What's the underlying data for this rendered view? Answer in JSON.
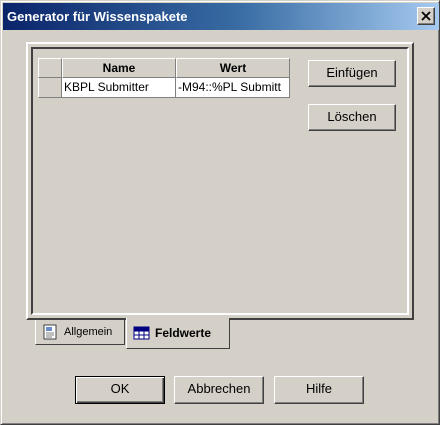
{
  "window": {
    "title": "Generator für Wissenspakete"
  },
  "grid": {
    "columns": [
      "",
      "Name",
      "Wert"
    ],
    "rows": [
      [
        "",
        "KBPL Submitter",
        "-M94::%PL Submitt"
      ]
    ]
  },
  "side_buttons": {
    "insert": "Einfügen",
    "delete": "Löschen"
  },
  "tabs": [
    {
      "label": "Allgemein",
      "icon": "document-icon",
      "active": false
    },
    {
      "label": "Feldwerte",
      "icon": "grid-icon",
      "active": true
    }
  ],
  "footer": {
    "ok": "OK",
    "cancel": "Abbrechen",
    "help": "Hilfe"
  }
}
